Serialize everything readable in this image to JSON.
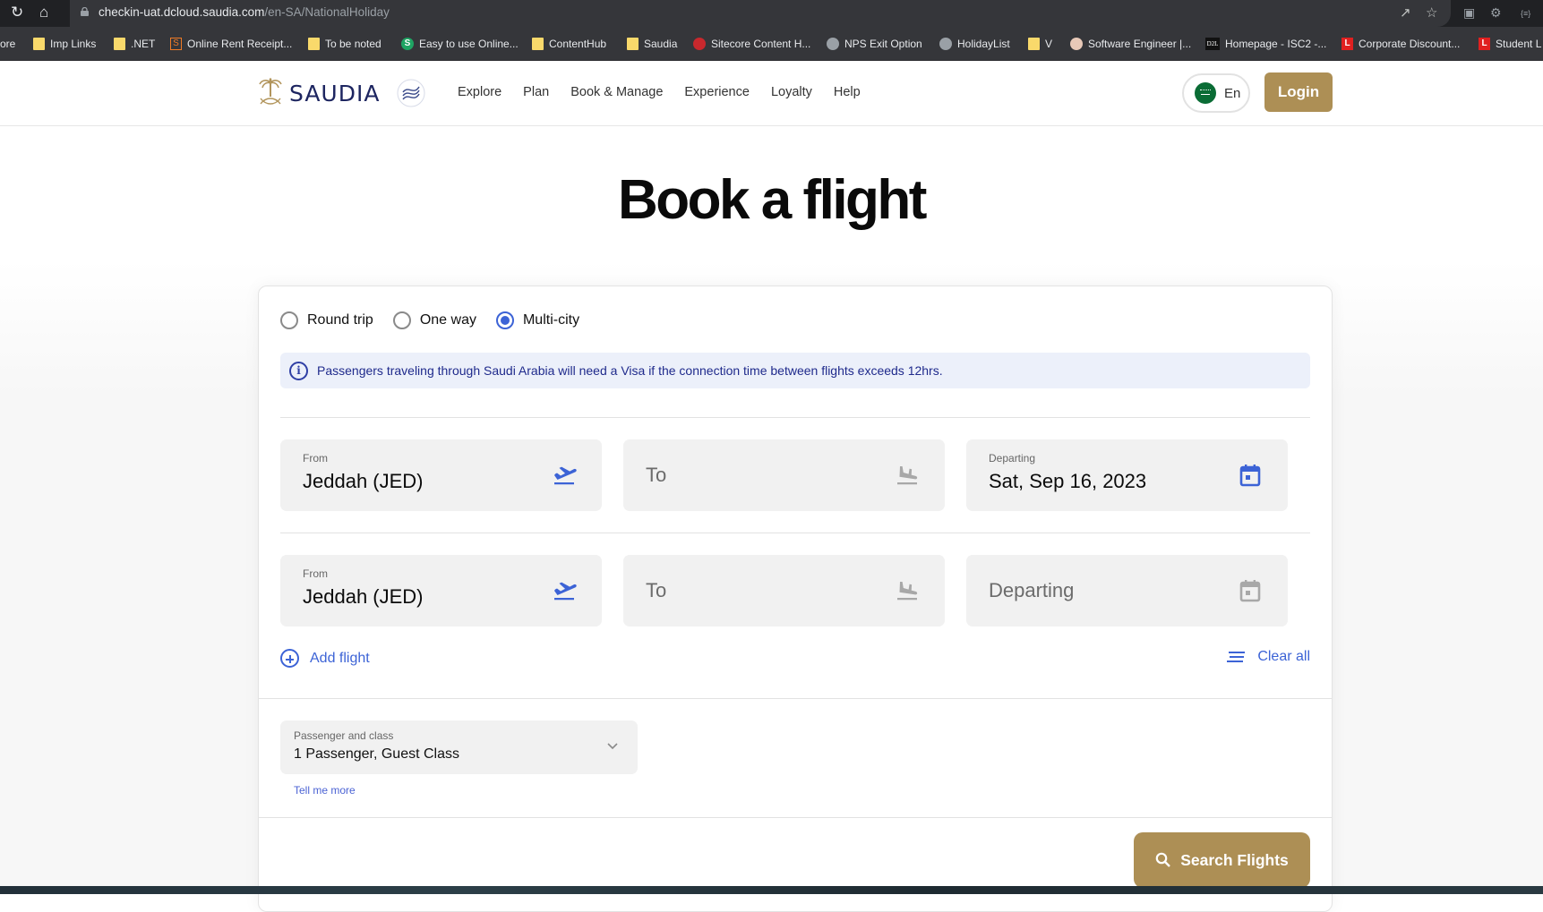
{
  "browser": {
    "url_host": "checkin-uat.dcloud.saudia.com",
    "url_path": "/en-SA/NationalHoliday",
    "bookmarks": [
      {
        "label": "ore",
        "icon": "none"
      },
      {
        "label": "Imp Links",
        "icon": "folder"
      },
      {
        "label": ".NET",
        "icon": "folder"
      },
      {
        "label": "Online Rent Receipt...",
        "icon": "s-orange"
      },
      {
        "label": "To be noted",
        "icon": "folder"
      },
      {
        "label": "Easy to use Online...",
        "icon": "s-green"
      },
      {
        "label": "ContentHub",
        "icon": "folder"
      },
      {
        "label": "Saudia",
        "icon": "folder"
      },
      {
        "label": "Sitecore Content H...",
        "icon": "sitecore"
      },
      {
        "label": "NPS Exit Option",
        "icon": "globe"
      },
      {
        "label": "HolidayList",
        "icon": "globe"
      },
      {
        "label": "V",
        "icon": "folder"
      },
      {
        "label": "Software Engineer |...",
        "icon": "avatar"
      },
      {
        "label": "Homepage - ISC2 -...",
        "icon": "d2l"
      },
      {
        "label": "Corporate Discount...",
        "icon": "red-l"
      },
      {
        "label": "Student L",
        "icon": "red-l"
      }
    ]
  },
  "header": {
    "brand": "SAUDIA",
    "nav": [
      "Explore",
      "Plan",
      "Book & Manage",
      "Experience",
      "Loyalty",
      "Help"
    ],
    "language": "En",
    "login_label": "Login",
    "brand_color": "#1d2560",
    "accent_color": "#ad8f55"
  },
  "page": {
    "title": "Book a flight"
  },
  "booking": {
    "trip_types": [
      {
        "label": "Round trip",
        "selected": false
      },
      {
        "label": "One way",
        "selected": false
      },
      {
        "label": "Multi-city",
        "selected": true
      }
    ],
    "info_message": "Passengers traveling through Saudi Arabia will need a Visa if the connection time between flights exceeds 12hrs.",
    "flights": [
      {
        "from_label": "From",
        "from_value": "Jeddah (JED)",
        "to_placeholder": "To",
        "departing_label": "Departing",
        "departing_value": "Sat, Sep 16, 2023"
      },
      {
        "from_label": "From",
        "from_value": "Jeddah (JED)",
        "to_placeholder": "To",
        "departing_placeholder": "Departing"
      }
    ],
    "add_flight_label": "Add flight",
    "clear_all_label": "Clear all",
    "passenger": {
      "label": "Passenger and class",
      "value": "1 Passenger, Guest Class",
      "tell_more": "Tell me more"
    },
    "search_label": "Search Flights",
    "link_color": "#3c63d6"
  }
}
